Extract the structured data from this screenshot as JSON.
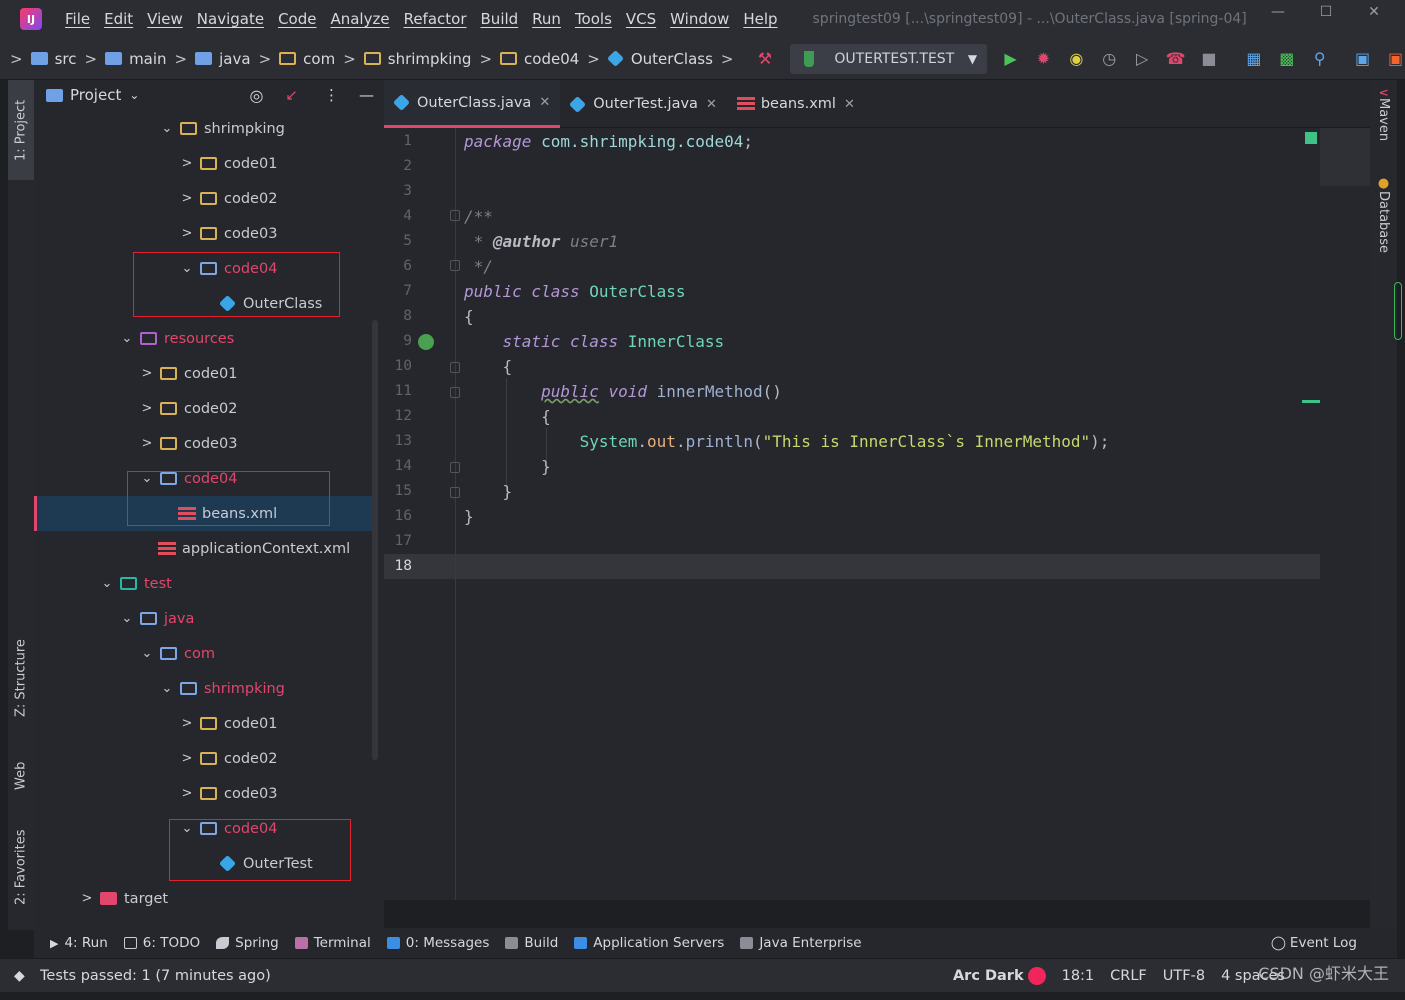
{
  "menubar": [
    "File",
    "Edit",
    "View",
    "Navigate",
    "Code",
    "Analyze",
    "Refactor",
    "Build",
    "Run",
    "Tools",
    "VCS",
    "Window",
    "Help"
  ],
  "window_title": "springtest09 [...\\springtest09] - ...\\OuterClass.java [spring-04]",
  "breadcrumbs": [
    "src",
    "main",
    "java",
    "com",
    "shrimpking",
    "code04",
    "OuterClass"
  ],
  "run_config": "OUTERTEST.TEST",
  "left_tabs": {
    "project": "1: Project",
    "structure": "Z: Structure",
    "web": "Web",
    "favorites": "2: Favorites"
  },
  "right_tabs": {
    "maven": "Maven",
    "database": "Database"
  },
  "project_panel": {
    "title": "Project",
    "tree": [
      {
        "label": "shrimpking",
        "type": "folder"
      },
      {
        "label": "code01",
        "type": "folder"
      },
      {
        "label": "code02",
        "type": "folder"
      },
      {
        "label": "code03",
        "type": "folder"
      },
      {
        "label": "code04",
        "type": "folder"
      },
      {
        "label": "OuterClass",
        "type": "class"
      },
      {
        "label": "resources",
        "type": "res"
      },
      {
        "label": "code01",
        "type": "folder"
      },
      {
        "label": "code02",
        "type": "folder"
      },
      {
        "label": "code03",
        "type": "folder"
      },
      {
        "label": "code04",
        "type": "folder"
      },
      {
        "label": "beans.xml",
        "type": "xml"
      },
      {
        "label": "applicationContext.xml",
        "type": "xml"
      },
      {
        "label": "test",
        "type": "folder"
      },
      {
        "label": "java",
        "type": "folder"
      },
      {
        "label": "com",
        "type": "folder"
      },
      {
        "label": "shrimpking",
        "type": "folder"
      },
      {
        "label": "code01",
        "type": "folder"
      },
      {
        "label": "code02",
        "type": "folder"
      },
      {
        "label": "code03",
        "type": "folder"
      },
      {
        "label": "code04",
        "type": "folder"
      },
      {
        "label": "OuterTest",
        "type": "class"
      },
      {
        "label": "target",
        "type": "folder"
      }
    ]
  },
  "tabs": [
    {
      "label": "OuterClass.java",
      "active": true
    },
    {
      "label": "OuterTest.java",
      "active": false
    },
    {
      "label": "beans.xml",
      "active": false
    }
  ],
  "editor": {
    "current_line": 18,
    "line_numbers": [
      "1",
      "2",
      "3",
      "4",
      "5",
      "6",
      "7",
      "8",
      "9",
      "10",
      "11",
      "12",
      "13",
      "14",
      "15",
      "16",
      "17",
      "18"
    ]
  },
  "tool_windows": [
    "4: Run",
    "6: TODO",
    "Spring",
    "Terminal",
    "0: Messages",
    "Build",
    "Application Servers",
    "Java Enterprise"
  ],
  "event_log": "Event Log",
  "status": {
    "message": "Tests passed: 1 (7 minutes ago)",
    "theme": "Arc Dark",
    "position": "18:1",
    "line_ending": "CRLF",
    "encoding": "UTF-8",
    "indent": "4 spaces"
  },
  "watermark": "CSDN @虾米大王",
  "colors": {
    "accent": "#e2466d",
    "selection": "#1e3a52",
    "run_green": "#48a050",
    "annotation_box": "#e2222c"
  }
}
